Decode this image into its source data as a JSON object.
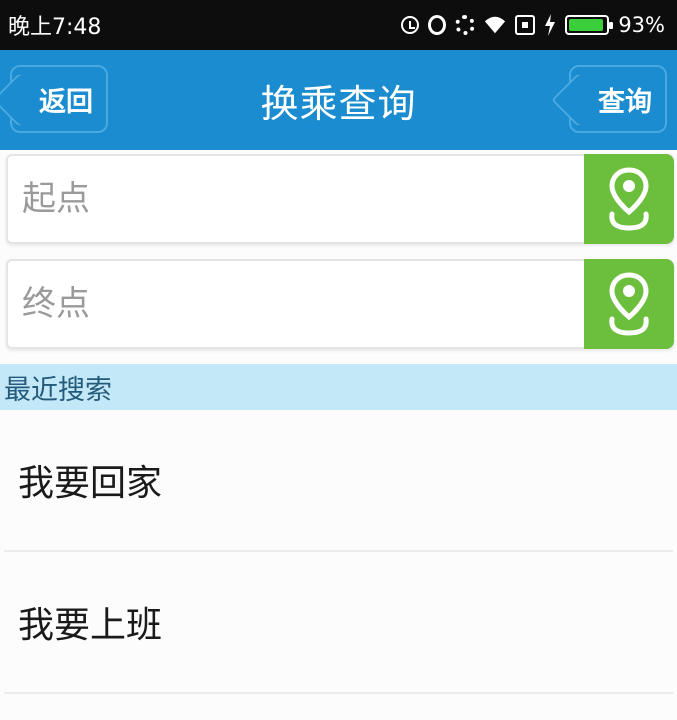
{
  "status_bar": {
    "time": "晚上7:48",
    "battery_percent": "93%",
    "battery_level": 0.93,
    "icons": [
      "alarm-icon",
      "ring-icon",
      "gear-icon",
      "wifi-icon",
      "box-icon",
      "charging-icon",
      "battery-icon"
    ]
  },
  "header": {
    "back_label": "返回",
    "title": "换乘查询",
    "query_label": "查询"
  },
  "form": {
    "start_placeholder": "起点",
    "start_value": "",
    "end_placeholder": "终点",
    "end_value": ""
  },
  "recent": {
    "header": "最近搜索",
    "items": [
      "我要回家",
      "我要上班"
    ]
  },
  "colors": {
    "status_bar": "#0d0d0d",
    "title_bar": "#1a8ccf",
    "location_button": "#6cbf3c",
    "recent_header": "#c3e8f8"
  }
}
